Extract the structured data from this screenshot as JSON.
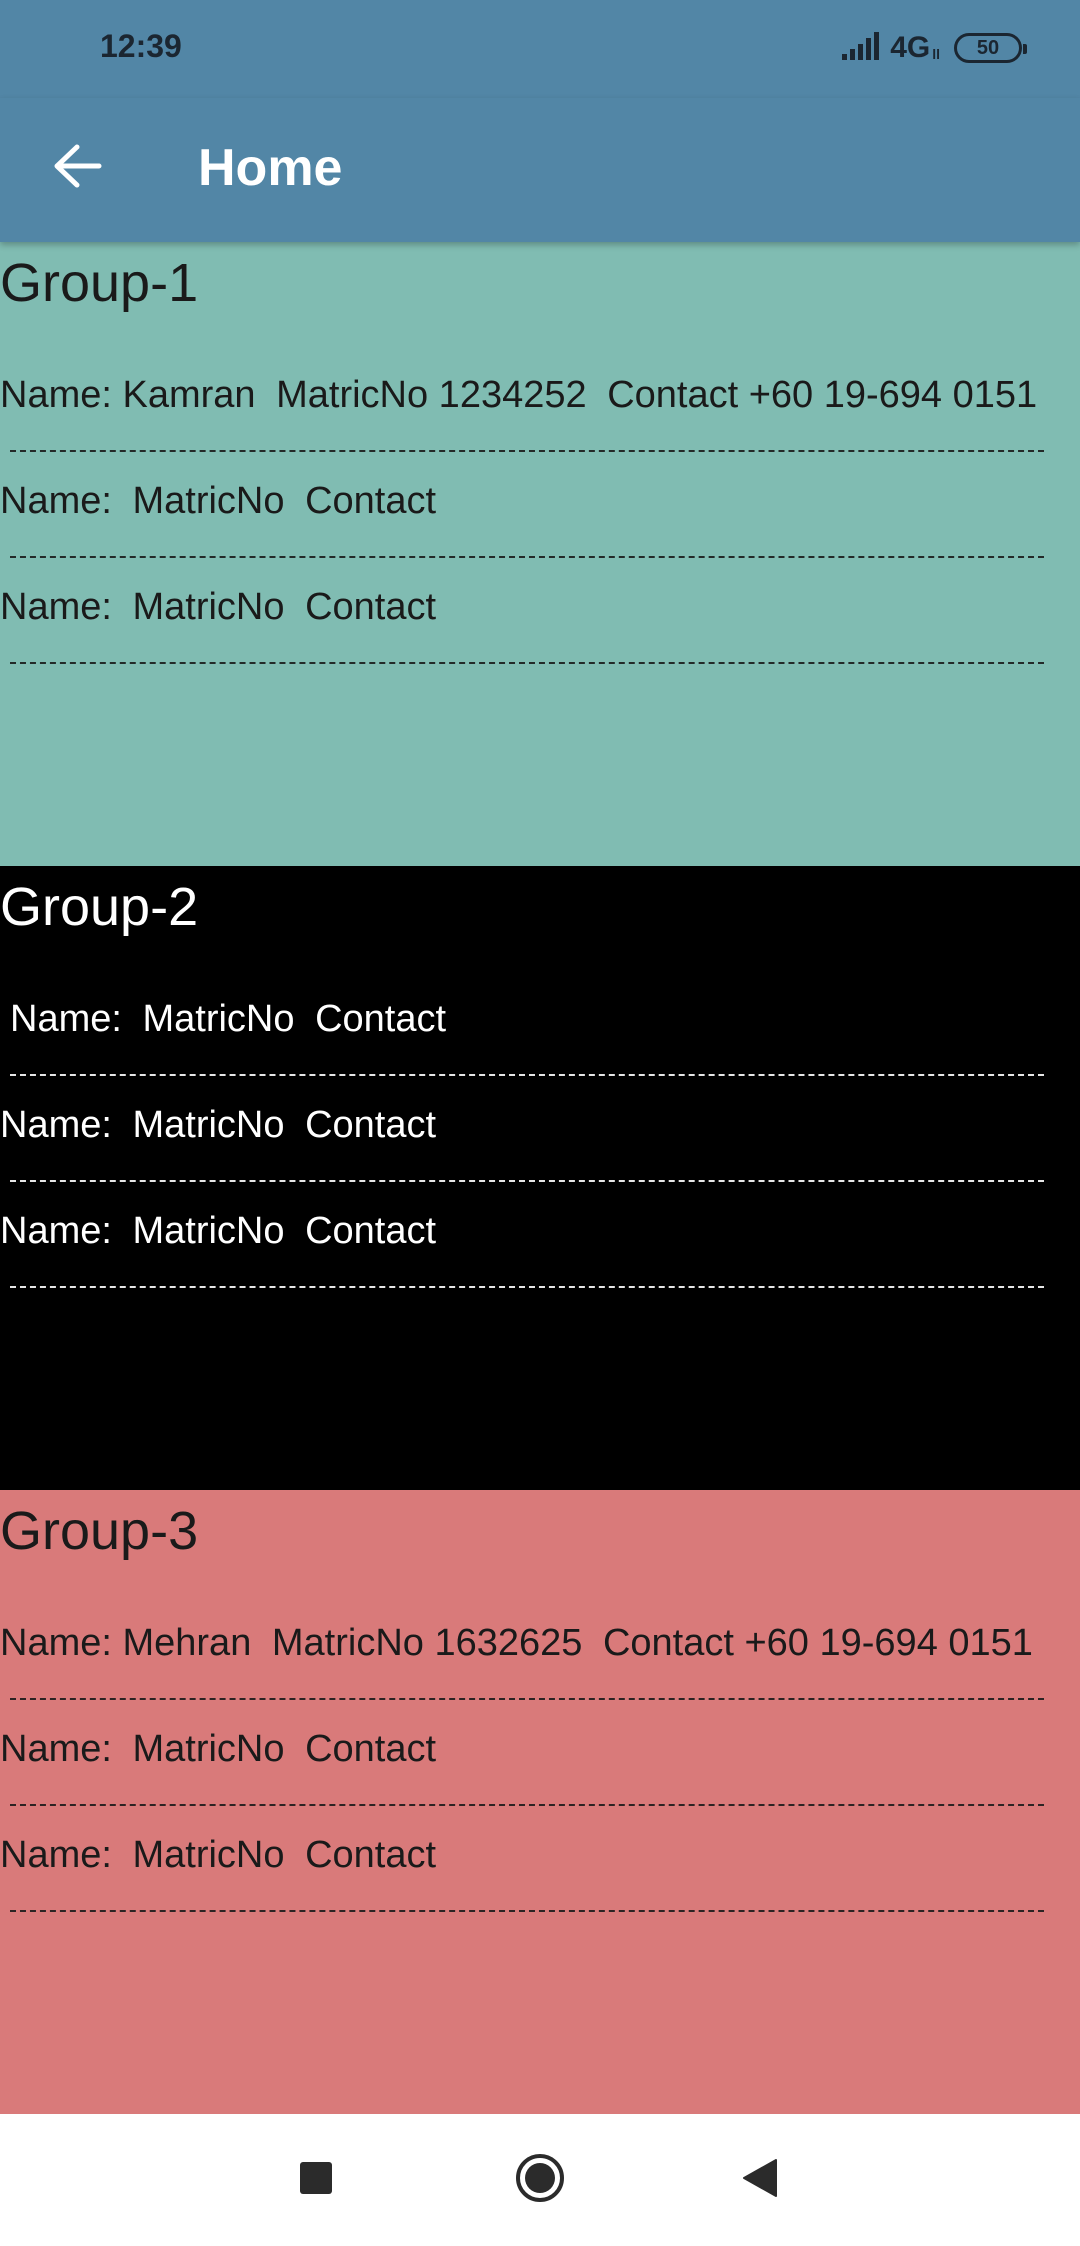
{
  "status_bar": {
    "time": "12:39",
    "network": "4G",
    "network_sub": "ll",
    "battery": "50"
  },
  "app_bar": {
    "title": "Home",
    "back_icon": "arrow-left-icon"
  },
  "groups": [
    {
      "title": "Group-1",
      "background": "#80bcb2",
      "rows": [
        {
          "name": "Name: Kamran",
          "matric": "MatricNo 1234252",
          "contact": "Contact +60 19-694 0151"
        },
        {
          "name": "Name: ",
          "matric": "MatricNo",
          "contact": "Contact"
        },
        {
          "name": "Name: ",
          "matric": "MatricNo",
          "contact": "Contact"
        }
      ]
    },
    {
      "title": "Group-2",
      "background": "#000000",
      "rows": [
        {
          "name": "Name: ",
          "matric": "MatricNo",
          "contact": "Contact"
        },
        {
          "name": "Name: ",
          "matric": "MatricNo",
          "contact": "Contact"
        },
        {
          "name": "Name: ",
          "matric": "MatricNo",
          "contact": "Contact"
        }
      ]
    },
    {
      "title": "Group-3",
      "background": "#d97a7a",
      "rows": [
        {
          "name": "Name: Mehran",
          "matric": "MatricNo 1632625",
          "contact": "Contact +60 19-694 0151"
        },
        {
          "name": "Name: ",
          "matric": "MatricNo",
          "contact": "Contact"
        },
        {
          "name": "Name: ",
          "matric": "MatricNo",
          "contact": "Contact"
        }
      ]
    }
  ],
  "nav_bar": {
    "recents_icon": "square-icon",
    "home_icon": "circle-home-icon",
    "back_icon": "triangle-back-icon"
  }
}
